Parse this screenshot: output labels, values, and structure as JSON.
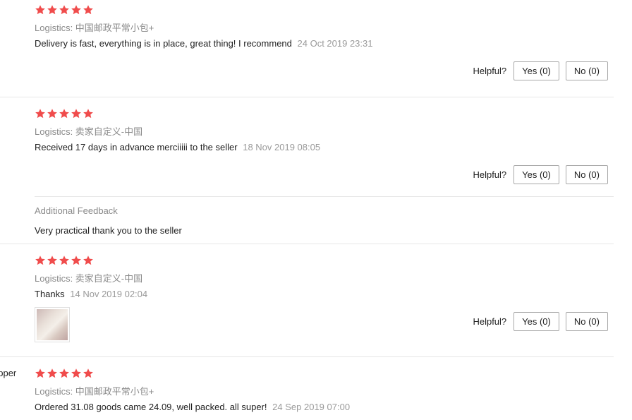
{
  "reviews": [
    {
      "rating": 5,
      "logistics": "Logistics: 中国邮政平常小包+",
      "text": "Delivery is fast, everything is in place, great thing! I recommend",
      "timestamp": "24 Oct 2019 23:31",
      "helpful_label": "Helpful?",
      "yes_label": "Yes (0)",
      "no_label": "No (0)"
    },
    {
      "rating": 5,
      "logistics": "Logistics: 卖家自定义-中国",
      "text": "Received 17 days in advance merciiiii to the seller",
      "timestamp": "18 Nov 2019 08:05",
      "helpful_label": "Helpful?",
      "yes_label": "Yes (0)",
      "no_label": "No (0)",
      "additional_feedback_label": "Additional Feedback",
      "additional_feedback_text": "Very practical thank you to the seller"
    },
    {
      "rating": 5,
      "logistics": "Logistics: 卖家自定义-中国",
      "text": "Thanks",
      "timestamp": "14 Nov 2019 02:04",
      "helpful_label": "Helpful?",
      "yes_label": "Yes (0)",
      "no_label": "No (0)",
      "photo_icon": "review-photo-thumbnail"
    },
    {
      "user_name_fragment": "opper",
      "rating": 5,
      "logistics": "Logistics: 中国邮政平常小包+",
      "text": "Ordered 31.08 goods came 24.09, well packed. all super!",
      "timestamp": "24 Sep 2019 07:00"
    }
  ],
  "colors": {
    "star": "#f04c4c",
    "muted_text": "#8a8a8a",
    "divider": "#e6e6e6"
  },
  "icons": {
    "star": "star-icon"
  }
}
